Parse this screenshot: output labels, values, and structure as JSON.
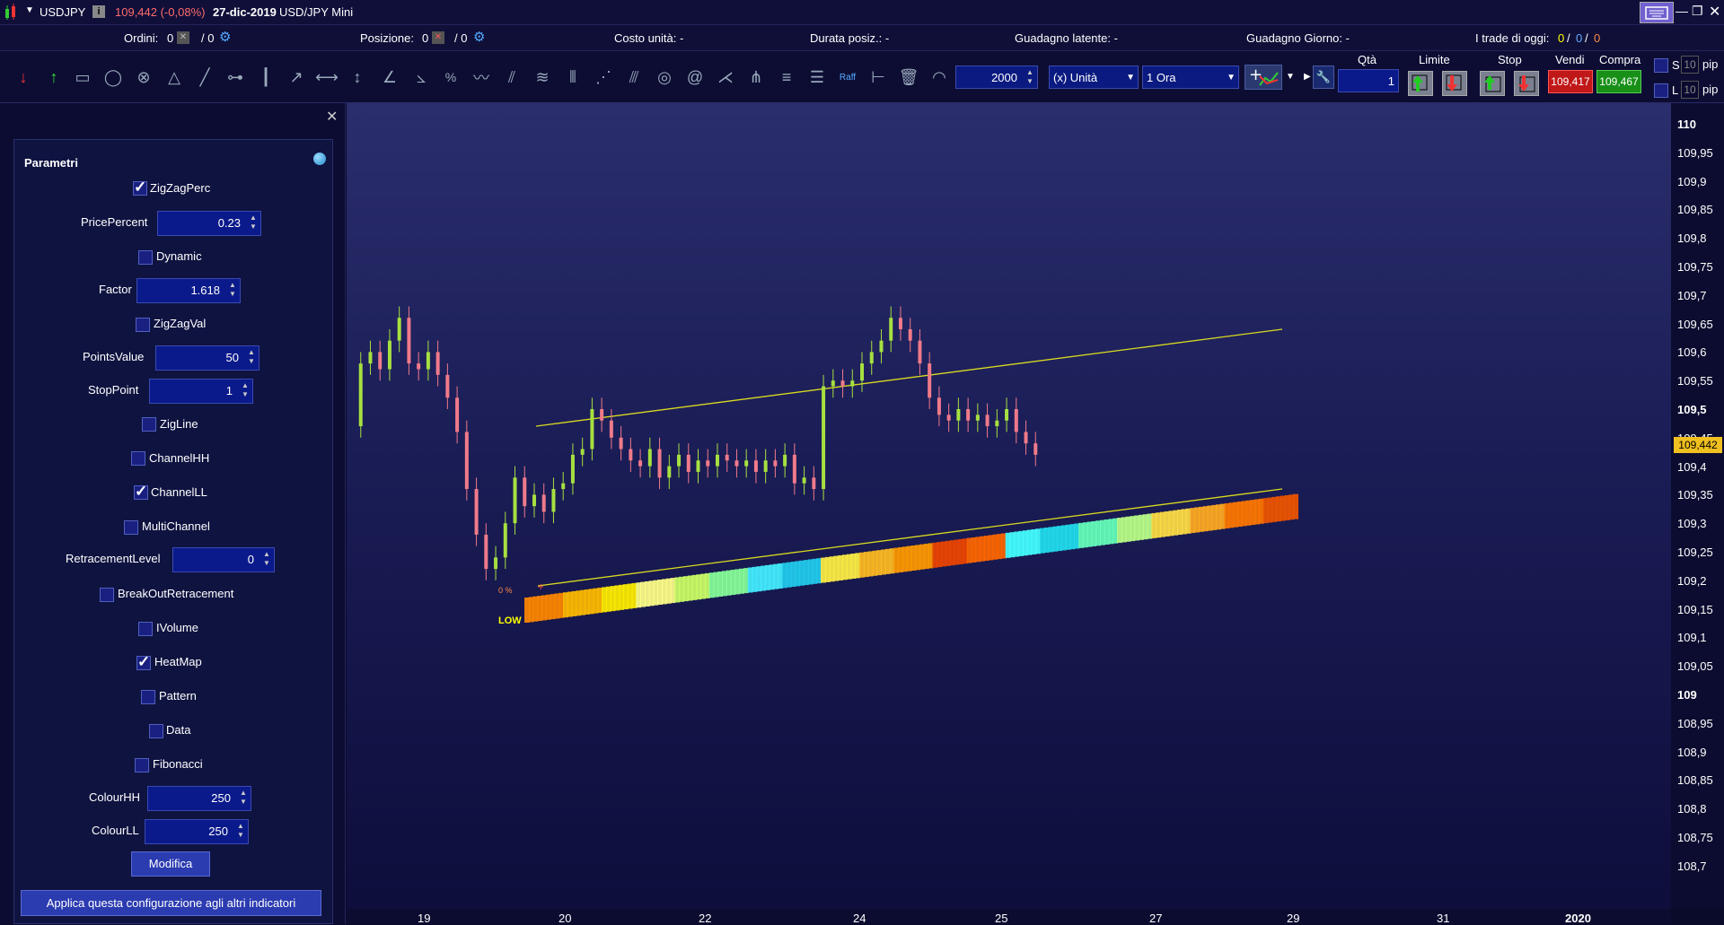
{
  "title": {
    "symbol": "USDJPY",
    "price_change": "109,442 (-0,08%)",
    "date": "27-dic-2019",
    "instrument": "USD/JPY Mini"
  },
  "infobar": {
    "orders_label": "Ordini:",
    "orders_a": "0",
    "orders_b": "/ 0",
    "position_label": "Posizione:",
    "position_a": "0",
    "position_b": "/ 0",
    "unit_cost": "Costo unità: -",
    "duration": "Durata posiz.: -",
    "latent_gain": "Guadagno latente: -",
    "day_gain": "Guadagno Giorno: -",
    "trades_today_label": "I trade di oggi:",
    "trades_a": "0",
    "trades_b": "0",
    "trades_c": "0"
  },
  "toolbar": {
    "quantity_value": "2000",
    "unit": "(x) Unità",
    "timeframe": "1 Ora",
    "qty_label": "Qtà",
    "qty_value": "1",
    "limit_label": "Limite",
    "stop_label": "Stop",
    "sell_label": "Vendi",
    "sell_price": "109,417",
    "buy_label": "Compra",
    "buy_price": "109,467",
    "s_label": "S",
    "l_label": "L",
    "pip_value": "10",
    "pip_unit": "pip",
    "raff_label": "Raff"
  },
  "params": {
    "header": "Parametri",
    "zigzagperc": "ZigZagPerc",
    "pricepercent_label": "PricePercent",
    "pricepercent_value": "0.23",
    "dynamic": "Dynamic",
    "factor_label": "Factor",
    "factor_value": "1.618",
    "zigzagval": "ZigZagVal",
    "pointsvalue_label": "PointsValue",
    "pointsvalue_value": "50",
    "stoppoint_label": "StopPoint",
    "stoppoint_value": "1",
    "zigline": "ZigLine",
    "channelhh": "ChannelHH",
    "channelll": "ChannelLL",
    "multichannel": "MultiChannel",
    "retracement_label": "RetracementLevel",
    "retracement_value": "0",
    "breakout": "BreakOutRetracement",
    "ivolume": "IVolume",
    "heatmap": "HeatMap",
    "pattern": "Pattern",
    "data": "Data",
    "fibonacci": "Fibonacci",
    "colourhh_label": "ColourHH",
    "colourhh_value": "250",
    "colourll_label": "ColourLL",
    "colourll_value": "250",
    "modify_button": "Modifica",
    "apply_button": "Applica questa configurazione agli altri indicatori"
  },
  "chart": {
    "current_price": "109,442",
    "low_label": "LOW",
    "pct_label": "0 %",
    "price_ticks": [
      "110",
      "109,95",
      "109,9",
      "109,85",
      "109,8",
      "109,75",
      "109,7",
      "109,65",
      "109,6",
      "109,55",
      "109,5",
      "109,45",
      "109,4",
      "109,35",
      "109,3",
      "109,25",
      "109,2",
      "109,15",
      "109,1",
      "109,05",
      "109",
      "108,95",
      "108,9",
      "108,85",
      "108,8",
      "108,75",
      "108,7"
    ],
    "time_ticks": [
      "19",
      "20",
      "22",
      "24",
      "25",
      "27",
      "29",
      "31",
      "2020"
    ]
  }
}
